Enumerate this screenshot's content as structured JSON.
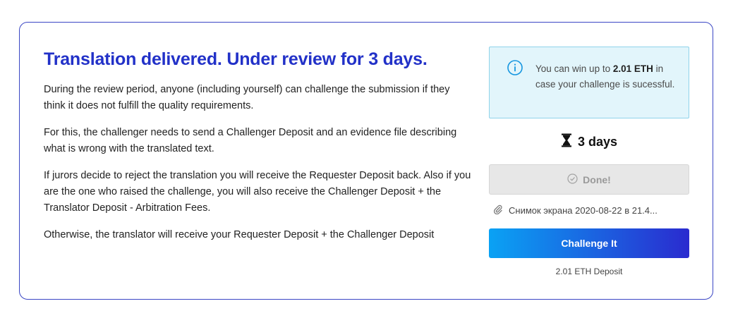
{
  "review": {
    "title": "Translation delivered. Under review for 3 days.",
    "paragraphs": [
      "During the review period, anyone (including yourself) can challenge the submission if they think it does not fulfill the quality requirements.",
      "For this, the challenger needs to send a Challenger Deposit and an evidence file describing what is wrong with the translated text.",
      "If jurors decide to reject the translation you will receive the Requester Deposit back. Also if you are the one who raised the challenge, you will also receive the Challenger Deposit + the Translator Deposit - Arbitration Fees.",
      "Otherwise, the translator will receive your Requester Deposit + the Challenger Deposit"
    ]
  },
  "info": {
    "prefix": "You can win up to ",
    "amount": "2.01 ETH",
    "suffix": " in case your challenge is sucessful.",
    "icon": "info-icon"
  },
  "timer": {
    "label": "3 days",
    "icon": "hourglass-icon"
  },
  "done_button": {
    "label": "Done!",
    "icon": "check-circle-icon"
  },
  "file": {
    "name": "Снимок экрана 2020-08-22 в 21.4...",
    "icon": "paperclip-icon"
  },
  "challenge_button": {
    "label": "Challenge It"
  },
  "deposit": {
    "label": "2.01 ETH Deposit"
  },
  "colors": {
    "accent": "#2231c8",
    "info_bg": "#e2f5fb",
    "info_border": "#8fd3ea",
    "gradient_start": "#0aa2f4",
    "gradient_end": "#2a2bcf"
  }
}
